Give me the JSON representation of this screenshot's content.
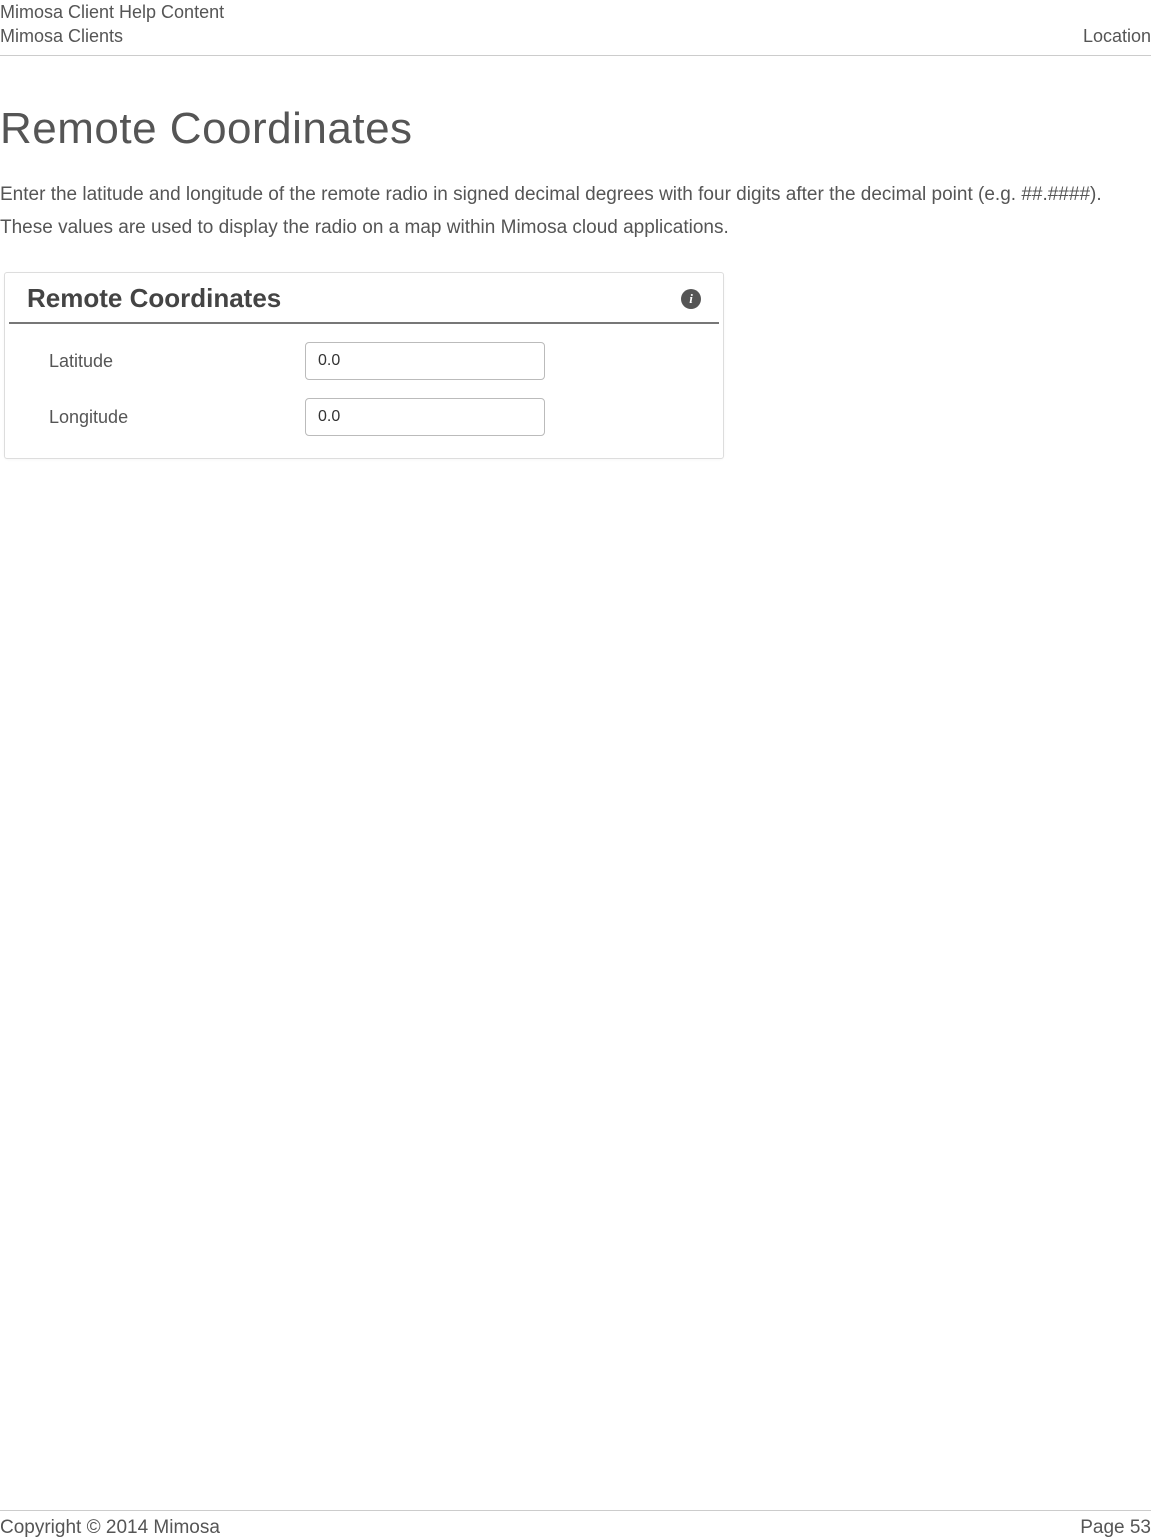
{
  "header": {
    "line1_left": "Mimosa Client Help Content",
    "line2_left": "Mimosa Clients",
    "line2_right": "Location"
  },
  "page": {
    "title": "Remote Coordinates",
    "intro": "Enter the latitude and longitude of the remote radio in signed decimal degrees with four digits after the decimal point (e.g. ##.####). These values are used to display the radio on a map within Mimosa cloud applications."
  },
  "panel": {
    "title": "Remote Coordinates",
    "info_glyph": "i",
    "fields": {
      "latitude": {
        "label": "Latitude",
        "value": "0.0"
      },
      "longitude": {
        "label": "Longitude",
        "value": "0.0"
      }
    }
  },
  "footer": {
    "copyright": "Copyright © 2014 Mimosa",
    "page": "Page 53"
  }
}
